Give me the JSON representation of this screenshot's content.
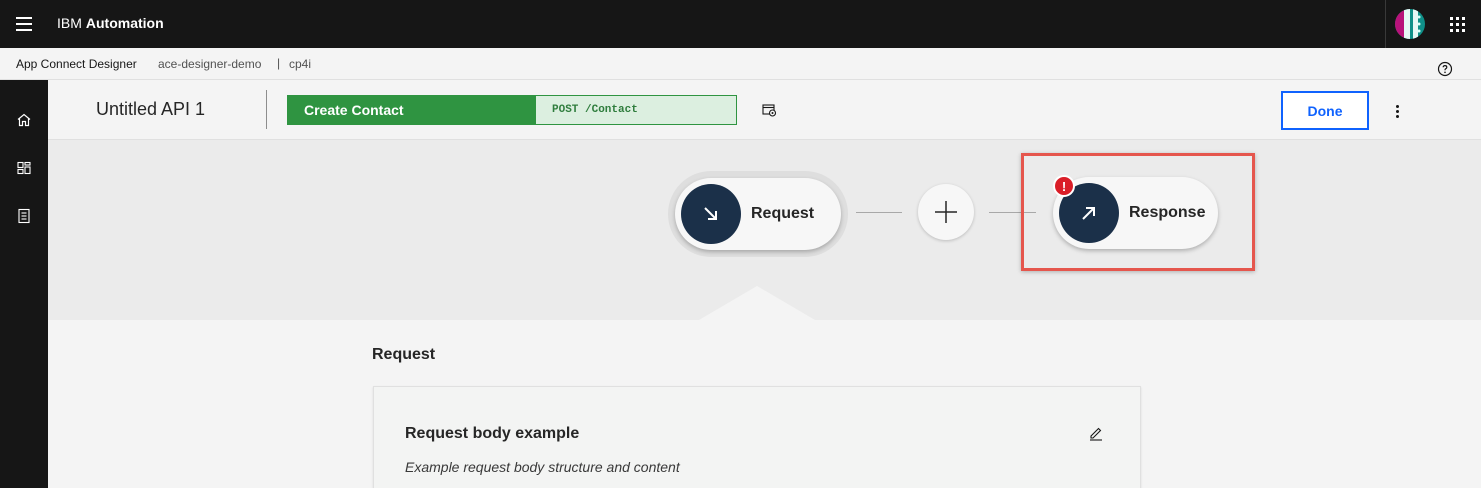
{
  "shell": {
    "brand_prefix": "IBM",
    "brand_name": "Automation",
    "menu_icon": "hamburger-menu-icon",
    "switcher_icon": "app-switcher-icon"
  },
  "subheader": {
    "app_name": "App Connect Designer",
    "instance": "ace-designer-demo",
    "separator": "|",
    "namespace": "cp4i"
  },
  "leftnav": {
    "items": [
      {
        "icon": "home-icon"
      },
      {
        "icon": "dashboard-icon"
      },
      {
        "icon": "catalog-icon"
      }
    ]
  },
  "editor": {
    "title": "Untitled API 1",
    "operation_name": "Create Contact",
    "operation_path": "POST /Contact",
    "done_label": "Done"
  },
  "flow": {
    "request_label": "Request",
    "response_label": "Response",
    "error_badge": "!"
  },
  "detail": {
    "section_title": "Request",
    "card_title": "Request body example",
    "card_description": "Example request body structure and content"
  },
  "colors": {
    "shell": "#161616",
    "operation_green": "#2f9441",
    "node_navy": "#1b3049",
    "primary_blue": "#0f62fe",
    "error_red": "#da1e28",
    "highlight": "#e5564d"
  }
}
